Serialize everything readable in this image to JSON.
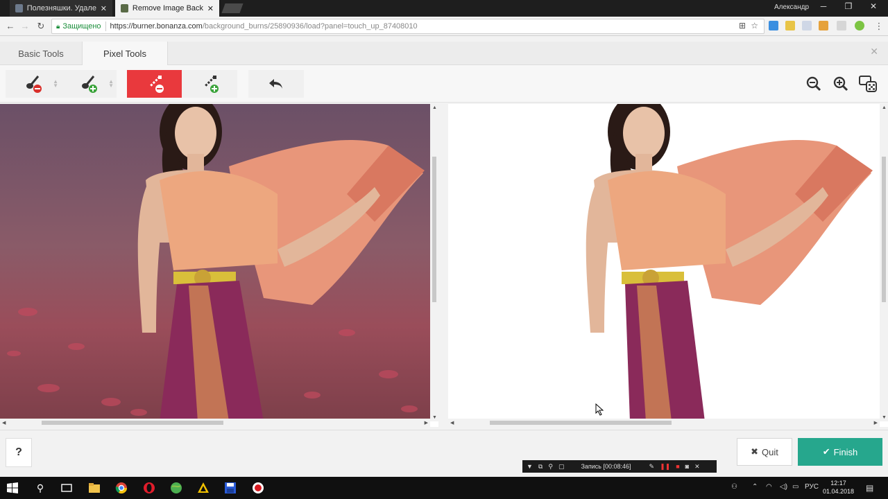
{
  "browser": {
    "tabs": [
      {
        "title": "Полезняшки. Удаление",
        "active": false,
        "favicon_color": "#6d7a8c"
      },
      {
        "title": "Remove Image Backgrou",
        "active": true,
        "favicon_color": "#5a6b47"
      }
    ],
    "user": "Александр",
    "secure_label": "Защищено",
    "url_host": "https://burner.bonanza.com",
    "url_path": "/background_burns/25890936/load?panel=touch_up_87408010"
  },
  "app": {
    "tabs": [
      {
        "label": "Basic Tools",
        "active": false
      },
      {
        "label": "Pixel Tools",
        "active": true
      }
    ],
    "tools": [
      {
        "name": "brush-remove",
        "active": false
      },
      {
        "name": "brush-keep",
        "active": false
      },
      {
        "name": "wand-remove",
        "active": true
      },
      {
        "name": "wand-keep",
        "active": false
      },
      {
        "name": "undo",
        "active": false
      }
    ],
    "accent_color": "#e9393d",
    "finish_color": "#26a78d",
    "help_label": "?",
    "quit_label": "Quit",
    "finish_label": "Finish"
  },
  "recorder": {
    "status": "Запись [00:08:46]"
  },
  "taskbar": {
    "tray_language": "РУС",
    "time": "12:17",
    "date": "01.04.2018"
  }
}
